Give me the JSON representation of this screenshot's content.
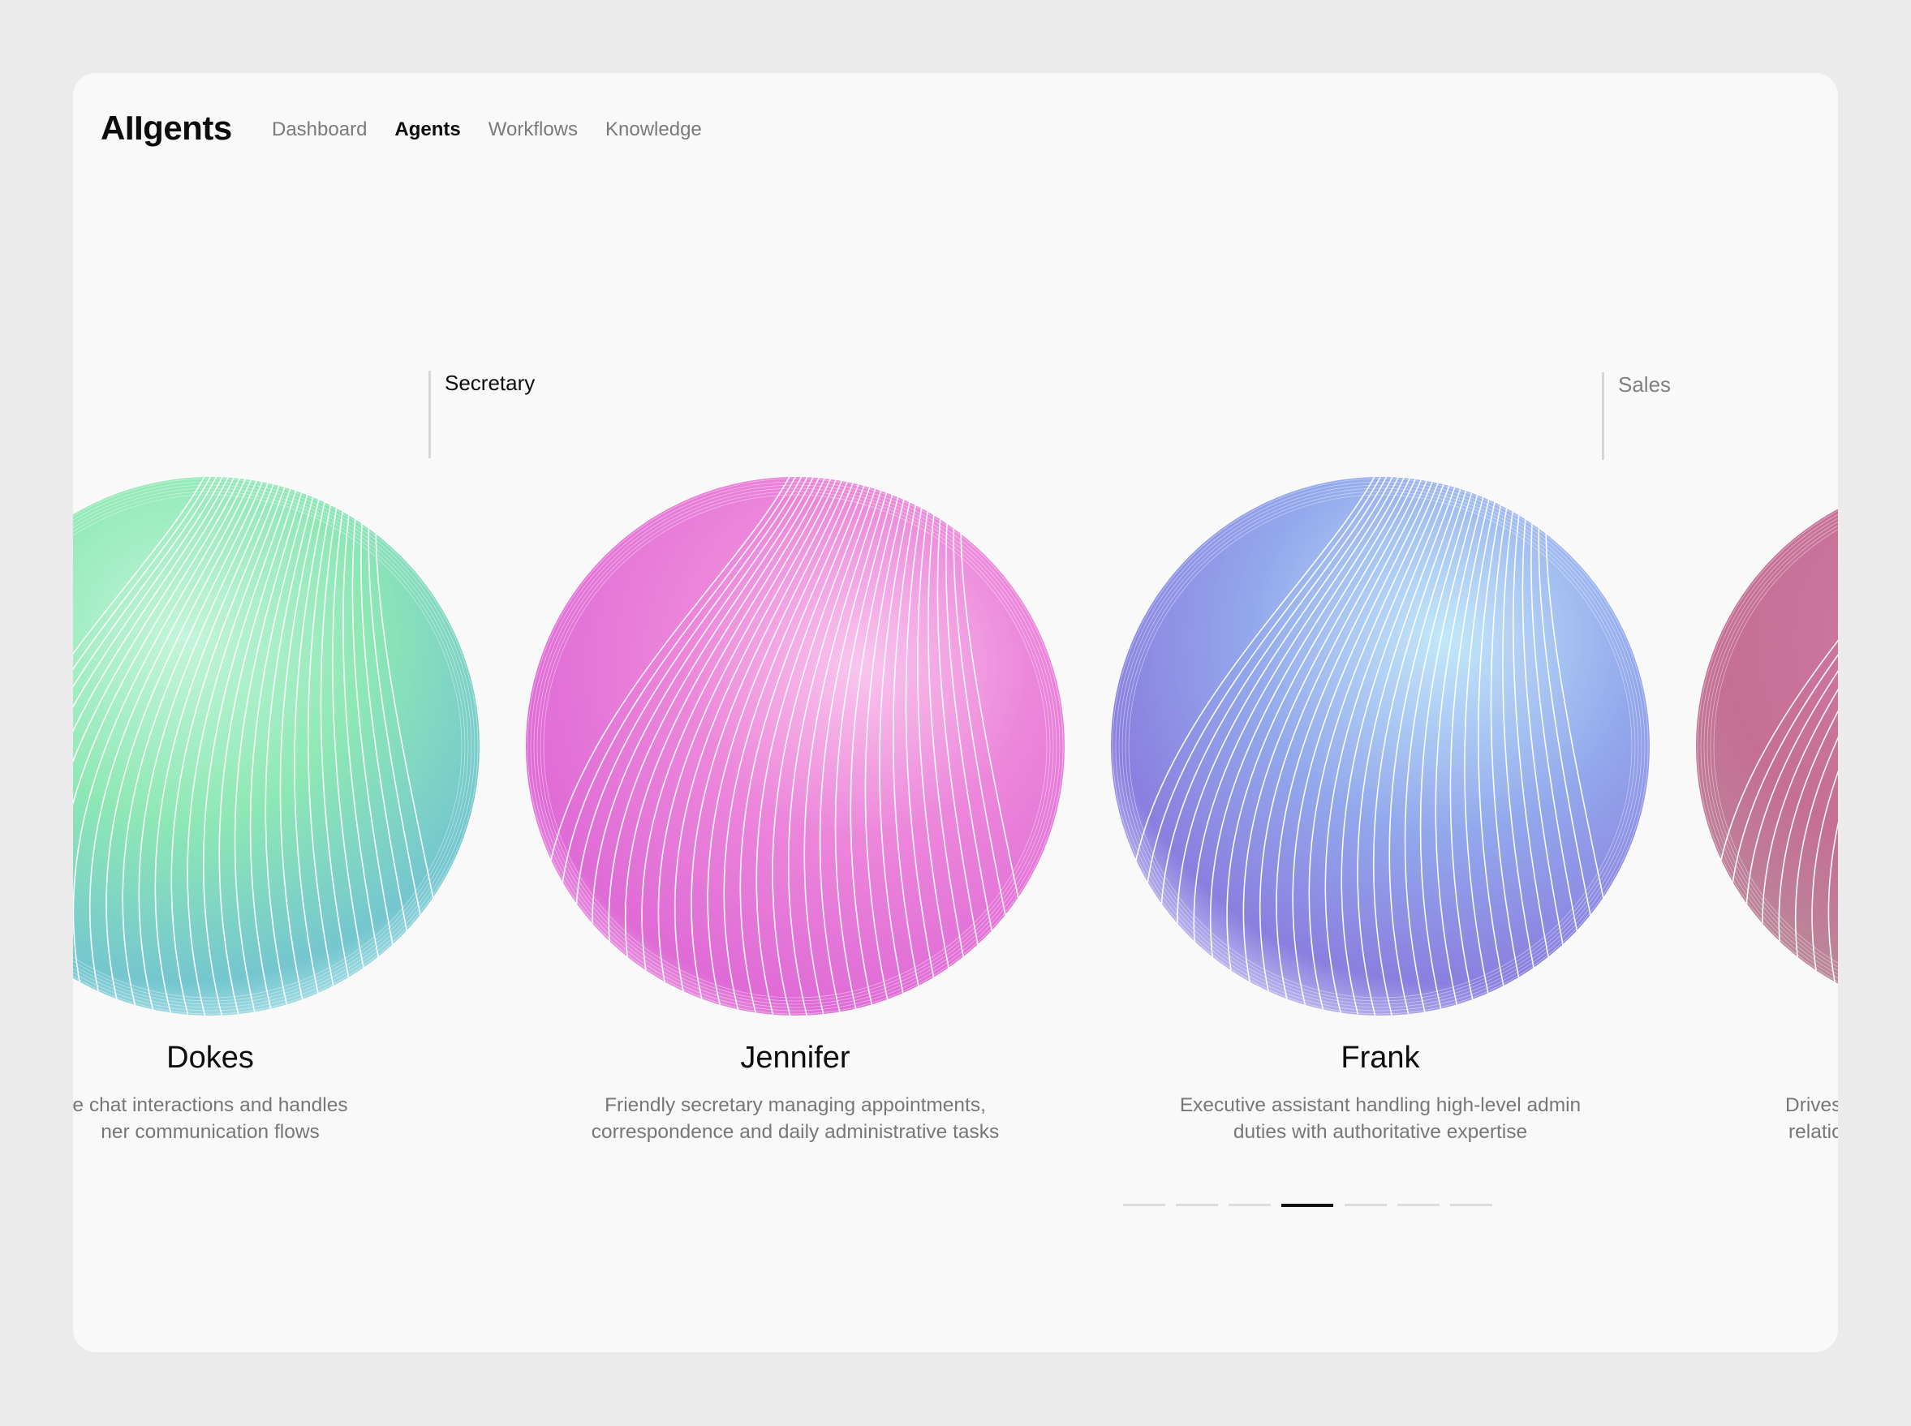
{
  "app": {
    "title": "AIIgents"
  },
  "nav": {
    "items": [
      {
        "label": "Dashboard",
        "active": false
      },
      {
        "label": "Agents",
        "active": true
      },
      {
        "label": "Workflows",
        "active": false
      },
      {
        "label": "Knowledge",
        "active": false
      }
    ]
  },
  "roles": {
    "secretary": "Secretary",
    "sales": "Sales"
  },
  "agents": [
    {
      "name": "Dokes",
      "desc_line1": "e chat interactions and handles",
      "desc_line2": "ner communication flows",
      "orb_icon": "green-sphere-icon",
      "colors": [
        "#8ee8b4",
        "#c3f5da",
        "#74c6cf"
      ]
    },
    {
      "name": "Jennifer",
      "desc_line1": "Friendly secretary managing appointments,",
      "desc_line2": "correspondence and daily administrative tasks",
      "orb_icon": "pink-sphere-icon",
      "colors": [
        "#e86fce",
        "#f7b3e6",
        "#df6bd6"
      ]
    },
    {
      "name": "Frank",
      "desc_line1": "Executive assistant handling high-level admin",
      "desc_line2": "duties with authoritative expertise",
      "orb_icon": "blue-sphere-icon",
      "colors": [
        "#7a8de6",
        "#bfe5f8",
        "#8a7fdf"
      ]
    },
    {
      "name": "",
      "desc_line1": "Drives sales p",
      "desc_line2": "relationships",
      "orb_icon": "rose-sphere-icon",
      "colors": [
        "#cf6a9b",
        "#e0b3c6",
        "#b98a9a"
      ]
    }
  ],
  "pager": {
    "total": 7,
    "active_index": 3
  }
}
